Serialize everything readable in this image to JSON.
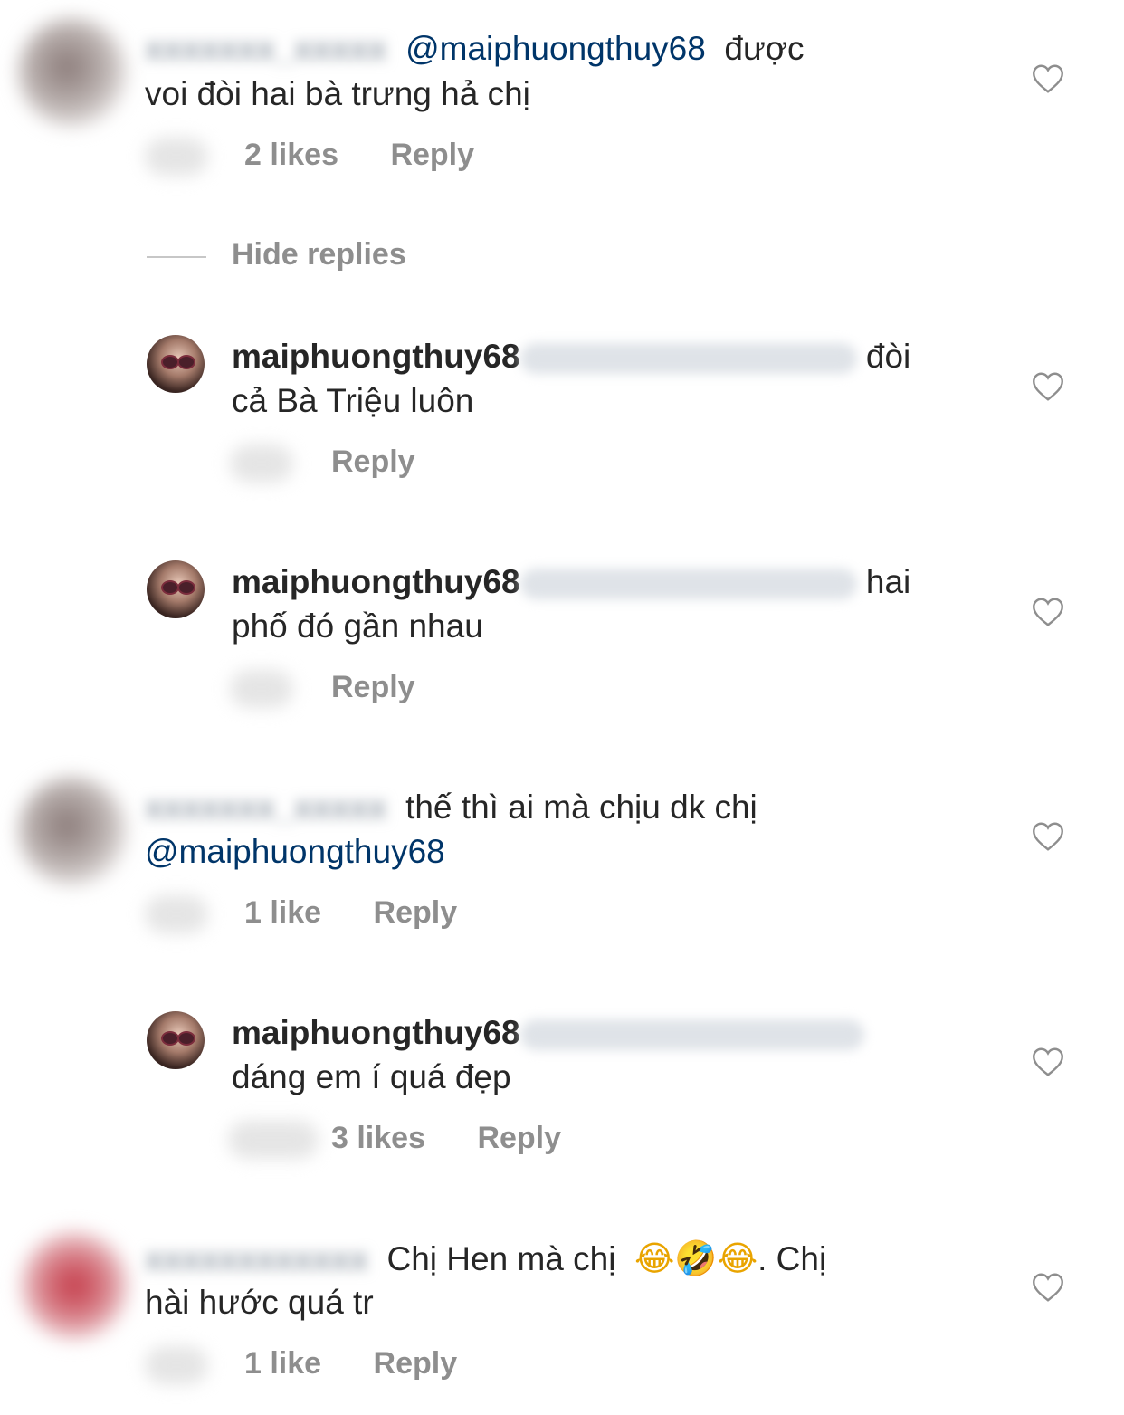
{
  "hide_replies_label": "Hide replies",
  "comments": [
    {
      "mention": "@maiphuongthuy68",
      "line1_text": "được",
      "line2_text": "voi đòi hai bà trưng hả chị",
      "likes": "2 likes",
      "reply": "Reply"
    },
    {
      "username": "maiphuongthuy68",
      "line1_text": "đòi",
      "line2_text": "cả Bà Triệu luôn",
      "reply": "Reply"
    },
    {
      "username": "maiphuongthuy68",
      "line1_text": "hai",
      "line2_text": "phố đó gần nhau",
      "reply": "Reply"
    },
    {
      "line1_text": "thế thì ai mà chịu dk chị",
      "mention": "@maiphuongthuy68",
      "likes": "1 like",
      "reply": "Reply"
    },
    {
      "username": "maiphuongthuy68",
      "line2_text": "dáng em í quá đẹp",
      "likes": "3 likes",
      "reply": "Reply"
    },
    {
      "line1_text": "Chị Hen mà chị",
      "emojis": "😂🤣😂",
      "line1_tail": ". Chị",
      "line2_text": "hài hước quá tr",
      "likes": "1 like",
      "reply": "Reply"
    }
  ],
  "colors": {
    "text": "#262626",
    "mention": "#003569",
    "meta": "#8e8e8e",
    "divider": "#c7c7c7"
  },
  "icons": {
    "like": "heart-outline-icon"
  }
}
